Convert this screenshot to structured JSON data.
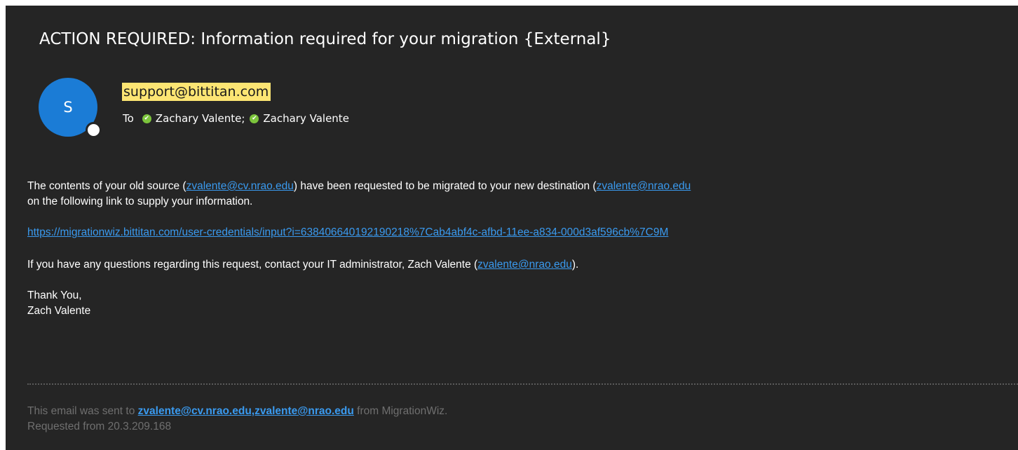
{
  "email": {
    "subject": "ACTION REQUIRED: Information required for your migration {External}",
    "avatar_initial": "S",
    "sender": "support@bittitan.com",
    "to_label": "To",
    "recipients": [
      "Zachary Valente",
      "Zachary Valente"
    ],
    "recipient_separator": ";"
  },
  "body": {
    "p1_a": "The contents of your old source (",
    "p1_link1": "zvalente@cv.nrao.edu",
    "p1_b": ") have been requested to be migrated to your new destination (",
    "p1_link2": "zvalente@nrao.edu",
    "p1_line2": "on the following link to supply your information.",
    "migration_link": "https://migrationwiz.bittitan.com/user-credentials/input?i=638406640192190218%7Cab4abf4c-afbd-11ee-a834-000d3af596cb%7C9M",
    "p3_a": "If you have any questions regarding this request, contact your IT administrator, Zach Valente (",
    "p3_link": "zvalente@nrao.edu",
    "p3_b": ").",
    "signoff": "Thank You,",
    "signature": "Zach Valente"
  },
  "footer": {
    "sent_to_prefix": "This email was sent to ",
    "sent_to_link": "zvalente@cv.nrao.edu,zvalente@nrao.edu",
    "sent_to_suffix": " from MigrationWiz.",
    "requested_from": "Requested from 20.3.209.168"
  },
  "colors": {
    "background": "#252525",
    "avatar": "#1b7cd6",
    "sender_highlight": "#fce573",
    "link": "#3a9aef",
    "presence_check": "#7cc43c",
    "footer_text": "#6f6f6f"
  }
}
